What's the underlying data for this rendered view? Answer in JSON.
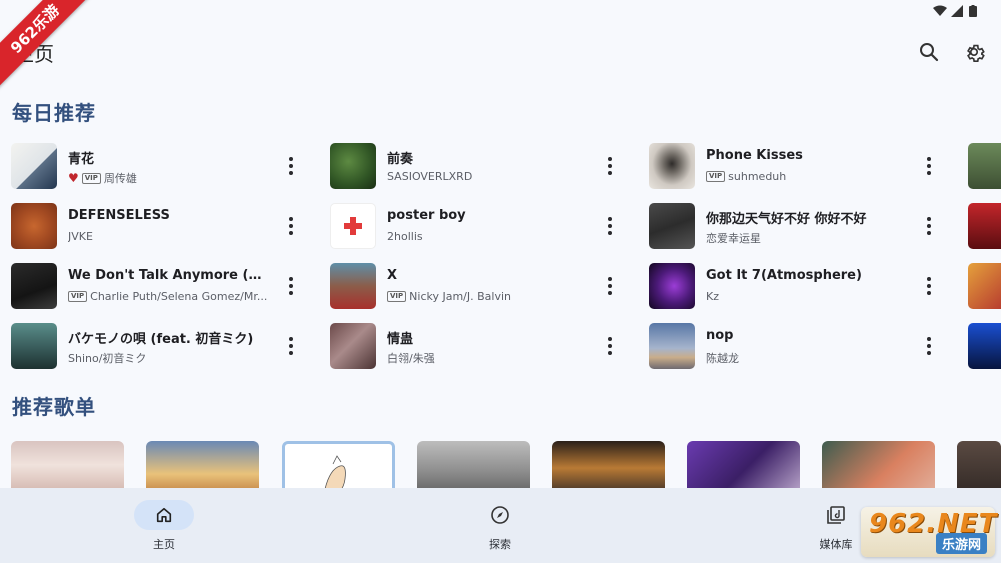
{
  "colors": {
    "accent": "#33507e",
    "nav_active": "#d4e3f8",
    "heart": "#c0262d",
    "badge": "#d9252b"
  },
  "app": {
    "title": "主页",
    "search_icon": "search-icon",
    "settings_icon": "gear-icon"
  },
  "corner_badge": "962乐游",
  "sections": {
    "daily": "每日推荐",
    "playlists": "推荐歌单"
  },
  "songs": [
    [
      {
        "title": "青花",
        "artist": "周传雄",
        "vip": "VIP",
        "liked": true
      },
      {
        "title": "DEFENSELESS",
        "artist": "JVKE"
      },
      {
        "title": "We Don't Talk Anymore (Mr. ...",
        "artist": "Charlie Puth/Selena Gomez/Mr...",
        "vip": "VIP"
      },
      {
        "title": "バケモノの唄 (feat. 初音ミク)",
        "artist": "Shino/初音ミク"
      }
    ],
    [
      {
        "title": "前奏",
        "artist": "SASIOVERLXRD"
      },
      {
        "title": "poster boy",
        "artist": "2hollis"
      },
      {
        "title": "X",
        "artist": "Nicky Jam/J. Balvin",
        "vip": "VIP"
      },
      {
        "title": "情蛊",
        "artist": "白翎/朱强"
      }
    ],
    [
      {
        "title": "Phone Kisses",
        "artist": "suhmeduh",
        "vip": "VIP"
      },
      {
        "title": "你那边天气好不好 你好不好",
        "artist": "恋爱幸运星"
      },
      {
        "title": "Got It 7(Atmosphere)",
        "artist": "Kz"
      },
      {
        "title": "nop",
        "artist": "陈越龙"
      }
    ]
  ],
  "nav": {
    "home": "主页",
    "explore": "探索",
    "library": "媒体库"
  },
  "watermark": {
    "main": "962.NET",
    "sub": "乐游网"
  }
}
